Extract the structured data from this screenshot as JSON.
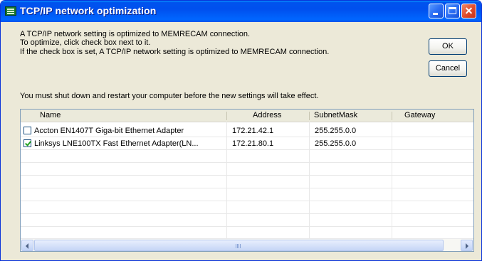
{
  "window": {
    "title": "TCP/IP network optimization",
    "icon": "network-adapter-icon"
  },
  "messages": {
    "line1": "A TCP/IP network setting is optimized to MEMRECAM connection.",
    "line2": "To optimize, click check box next to it.",
    "line3": "If the check box is set, A TCP/IP network setting is optimized to MEMRECAM connection.",
    "restart_notice": "You must shut down and restart your computer before the new settings will take effect."
  },
  "buttons": {
    "ok": "OK",
    "cancel": "Cancel"
  },
  "table": {
    "columns": [
      "Name",
      "Address",
      "SubnetMask",
      "Gateway"
    ],
    "rows": [
      {
        "checked": false,
        "name": "Accton EN1407T Giga-bit Ethernet Adapter",
        "address": "172.21.42.1",
        "subnet": "255.255.0.0",
        "gateway": ""
      },
      {
        "checked": true,
        "name": "Linksys LNE100TX Fast Ethernet Adapter(LN...",
        "address": "172.21.80.1",
        "subnet": "255.255.0.0",
        "gateway": ""
      }
    ]
  },
  "colors": {
    "titlebar": "#0054e3",
    "window_bg": "#ece9d8",
    "close_button": "#e04a2a"
  }
}
